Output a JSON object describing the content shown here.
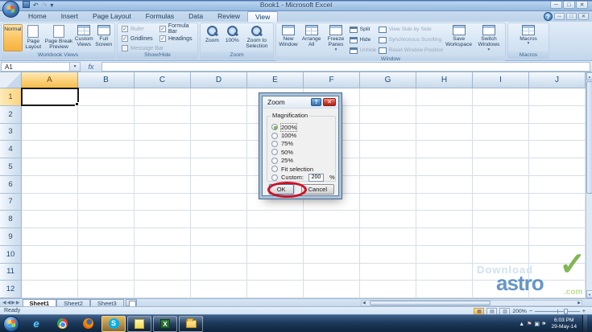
{
  "titlebar": {
    "title": "Book1 - Microsoft Excel"
  },
  "icons": {
    "undo": "↶",
    "redo": "↷",
    "dropdown": "▾",
    "help": "?",
    "close": "✕",
    "min": "─",
    "max": "□",
    "left": "◀",
    "right": "▶",
    "up": "▲",
    "down": "▼",
    "plus": "+",
    "minus": "−",
    "check": "✓",
    "view_normal": "▦",
    "view_layout": "▤",
    "view_break": "▥"
  },
  "ribbon": {
    "tabs": [
      {
        "label": "Home"
      },
      {
        "label": "Insert"
      },
      {
        "label": "Page Layout"
      },
      {
        "label": "Formulas"
      },
      {
        "label": "Data"
      },
      {
        "label": "Review"
      },
      {
        "label": "View",
        "active": true
      }
    ],
    "workbook_views": {
      "label": "Workbook Views",
      "buttons": [
        {
          "label": "Normal",
          "active": true
        },
        {
          "label": "Page Layout"
        },
        {
          "label": "Page Break Preview"
        },
        {
          "label": "Custom Views"
        },
        {
          "label": "Full Screen"
        }
      ]
    },
    "show_hide": {
      "label": "Show/Hide",
      "items": [
        {
          "label": "Ruler",
          "checked": true,
          "disabled": true
        },
        {
          "label": "Gridlines",
          "checked": true,
          "disabled": false
        },
        {
          "label": "Message Bar",
          "checked": false,
          "disabled": true
        },
        {
          "label": "Formula Bar",
          "checked": true,
          "disabled": false
        },
        {
          "label": "Headings",
          "checked": true,
          "disabled": false
        }
      ]
    },
    "zoom": {
      "label": "Zoom",
      "buttons": [
        {
          "label": "Zoom"
        },
        {
          "label": "100%"
        },
        {
          "label": "Zoom to Selection"
        }
      ]
    },
    "window": {
      "label": "Window",
      "big1": [
        {
          "label": "New Window"
        },
        {
          "label": "Arrange All"
        },
        {
          "label": "Freeze Panes",
          "dropdown": true
        }
      ],
      "small_icons": [
        {
          "label": "Split"
        },
        {
          "label": "Hide"
        },
        {
          "label": "Unhide",
          "disabled": true
        }
      ],
      "small_text": [
        {
          "label": "View Side by Side",
          "disabled": true
        },
        {
          "label": "Synchronous Scrolling",
          "disabled": true
        },
        {
          "label": "Reset Window Position",
          "disabled": true
        }
      ],
      "big2": [
        {
          "label": "Save Workspace"
        },
        {
          "label": "Switch Windows",
          "dropdown": true
        }
      ]
    },
    "macros": {
      "label": "Macros",
      "buttons": [
        {
          "label": "Macros",
          "dropdown": true
        }
      ]
    }
  },
  "formula_bar": {
    "name_box": "A1",
    "fx": "fx"
  },
  "grid": {
    "columns": [
      "A",
      "B",
      "C",
      "D",
      "E",
      "F",
      "G",
      "H",
      "I",
      "J"
    ],
    "rows": [
      "1",
      "2",
      "3",
      "4",
      "5",
      "6",
      "7",
      "8",
      "9",
      "10",
      "11",
      "12"
    ],
    "selected_cell": "A1",
    "selected_col": "A",
    "selected_row": "1"
  },
  "dialog": {
    "title": "Zoom",
    "group_label": "Magnification",
    "options": [
      {
        "label": "200%",
        "selected": true
      },
      {
        "label": "100%"
      },
      {
        "label": "75%"
      },
      {
        "label": "50%"
      },
      {
        "label": "25%"
      },
      {
        "label": "Fit selection"
      },
      {
        "label": "Custom:",
        "custom": true
      }
    ],
    "custom_value": "200",
    "custom_unit": "%",
    "buttons": {
      "ok": "OK",
      "cancel": "Cancel"
    }
  },
  "sheet_bar": {
    "tabs": [
      {
        "label": "Sheet1",
        "active": true
      },
      {
        "label": "Sheet2"
      },
      {
        "label": "Sheet3"
      }
    ]
  },
  "status_bar": {
    "mode": "Ready",
    "zoom_level": "200%"
  },
  "watermark": {
    "word1": "Download",
    "word2": "astro",
    "word3": ".com"
  },
  "taskbar": {
    "time": "6:03 PM",
    "date": "29-May-14"
  }
}
